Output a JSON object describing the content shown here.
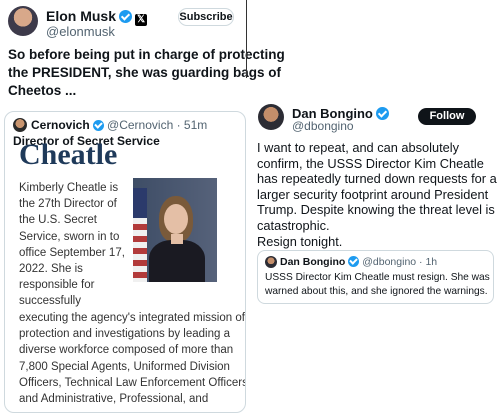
{
  "left_post": {
    "author_name": "Elon Musk",
    "handle": "@elonmusk",
    "subscribe_label": "Subscribe",
    "body_lines": [
      "So before being put in charge of protecting",
      "the PRESIDENT, she was guarding bags of",
      "Cheetos ..."
    ],
    "quote": {
      "author_name": "Cernovich",
      "handle_time": "@Cernovich · 51m",
      "title": "Director of Secret Service",
      "heading": "Cheatle",
      "wrap_lines": [
        "Kimberly Cheatle is",
        "the 27th Director of",
        "the U.S. Secret",
        "Service, sworn in to",
        "office September 17,",
        "2022. She is",
        "responsible for",
        "successfully"
      ],
      "full_lines": [
        "executing the agency's integrated mission of",
        "protection and investigations by leading a",
        "diverse workforce composed of more than",
        "7,800 Special Agents, Uniformed Division",
        "Officers, Technical Law Enforcement Officers,",
        "and Administrative, Professional, and"
      ]
    }
  },
  "right_post": {
    "author_name": "Dan Bongino",
    "handle": "@dbongino",
    "follow_label": "Follow",
    "body_lines": [
      "I want to repeat, and can absolutely",
      "confirm, the USSS Director Kim Cheatle",
      "has repeatedly turned down requests for a",
      "larger security footprint around President",
      "Trump. Despite knowing the threat level is",
      "catastrophic.",
      "Resign tonight."
    ],
    "quote": {
      "author_name": "Dan Bongino",
      "handle_time": "@dbongino · 1h",
      "lines": [
        "USSS Director Kim Cheatle must resign. She was",
        "warned about this, and she ignored the warnings."
      ]
    }
  },
  "colors": {
    "verified": "#1d9bf0",
    "handle_gray": "#536471",
    "follow_bg": "#0f1419",
    "border": "#cfd9de"
  },
  "icons": {
    "verified": "verified-badge-icon",
    "x_logo": "x-logo-icon"
  }
}
